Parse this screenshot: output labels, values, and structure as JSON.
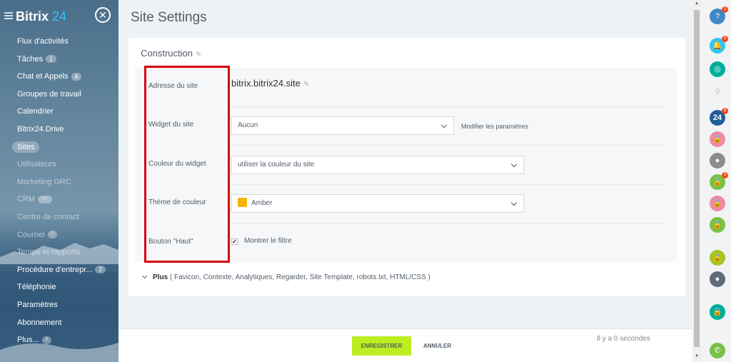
{
  "sidebar": {
    "logo_text": "Bitrix",
    "logo_num": "24",
    "close_symbol": "✕",
    "items": [
      {
        "label": "Flux d'activités",
        "badge": ""
      },
      {
        "label": "Tâches",
        "badge": "1"
      },
      {
        "label": "Chat et Appels",
        "badge": "4"
      },
      {
        "label": "Groupes de travail",
        "badge": ""
      },
      {
        "label": "Calendrier",
        "badge": ""
      },
      {
        "label": "Bitrix24.Drive",
        "badge": ""
      },
      {
        "label": "Sites",
        "badge": ""
      },
      {
        "label": "Utilisateurs",
        "badge": ""
      },
      {
        "label": "Marketing GRC",
        "badge": ""
      },
      {
        "label": "CRM",
        "badge": "50+"
      },
      {
        "label": "Centre de contact",
        "badge": ""
      },
      {
        "label": "Courriel",
        "badge": "5"
      },
      {
        "label": "Temps et rapports",
        "badge": ""
      },
      {
        "label": "Procédure d'entrepr...",
        "badge": "2"
      },
      {
        "label": "Téléphonie",
        "badge": ""
      },
      {
        "label": "Paramètres",
        "badge": ""
      },
      {
        "label": "Abonnement",
        "badge": ""
      },
      {
        "label": "Plus...",
        "badge": "2"
      }
    ]
  },
  "header": {
    "title": "Site Settings"
  },
  "section": {
    "title": "Construction"
  },
  "form": {
    "address_label": "Adresse du site",
    "address_value": "bitrix.bitrix24.site",
    "widget_label": "Widget du site",
    "widget_value": "Aucun",
    "widget_modify": "Modifier les paramètres",
    "color_label": "Couleur du widget",
    "color_value": "utiliser la couleur du site",
    "theme_label": "Thème de couleur",
    "theme_value": "Amber",
    "theme_color": "#f5b400",
    "top_button_label": "Bouton \"Haut\"",
    "top_button_check_label": "Montrer le filtre",
    "top_button_checked": "✔"
  },
  "more": {
    "label": "Plus",
    "items": "( Favicon,  Contexte,  Analytiques,  Regarder,  Site Template,  robots.txt,  HTML/CSS )"
  },
  "footer": {
    "save_label": "ENREGISTRER",
    "cancel_label": "ANNULER",
    "timestamp": "Il y a 0 secondes"
  },
  "rightbar": {
    "help_badge": "1",
    "notif_badge": "5",
    "b24_label": "24",
    "b24_badge": "1",
    "lock_badge": "3"
  },
  "colors": {
    "accent_green": "#bbed21",
    "highlight_red": "#d8000c",
    "brand_blue": "#2fc6f6"
  }
}
